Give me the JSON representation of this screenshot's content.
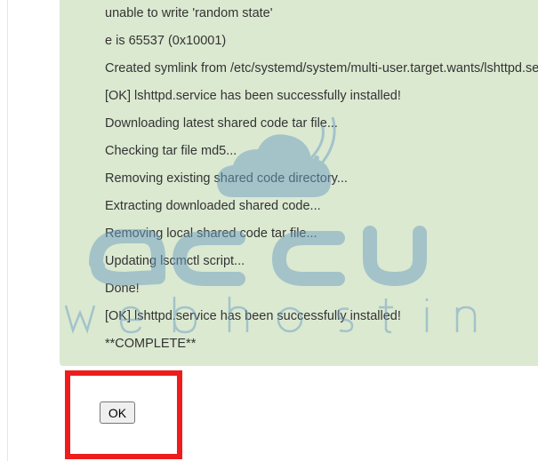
{
  "console": {
    "lines": [
      "unable to write 'random state'",
      "e is 65537 (0x10001)",
      "Created symlink from /etc/systemd/system/multi-user.target.wants/lshttpd.service",
      "[OK] lshttpd.service has been successfully installed!",
      "Downloading latest shared code tar file...",
      "Checking tar file md5...",
      "Removing existing shared code directory...",
      "Extracting downloaded shared code...",
      "Removing local shared code tar file...",
      "Updating lscmctl script...",
      "Done!",
      "[OK] lshttpd.service has been successfully installed!",
      "**COMPLETE**"
    ]
  },
  "dialog": {
    "ok_label": "OK"
  },
  "watermark": {
    "brand": "accu",
    "tagline": "web hosting"
  },
  "colors": {
    "console_bg": "#dbe9d1",
    "console_text": "#333333",
    "highlight": "#ee1c1c",
    "watermark": "#6c9ec2"
  }
}
